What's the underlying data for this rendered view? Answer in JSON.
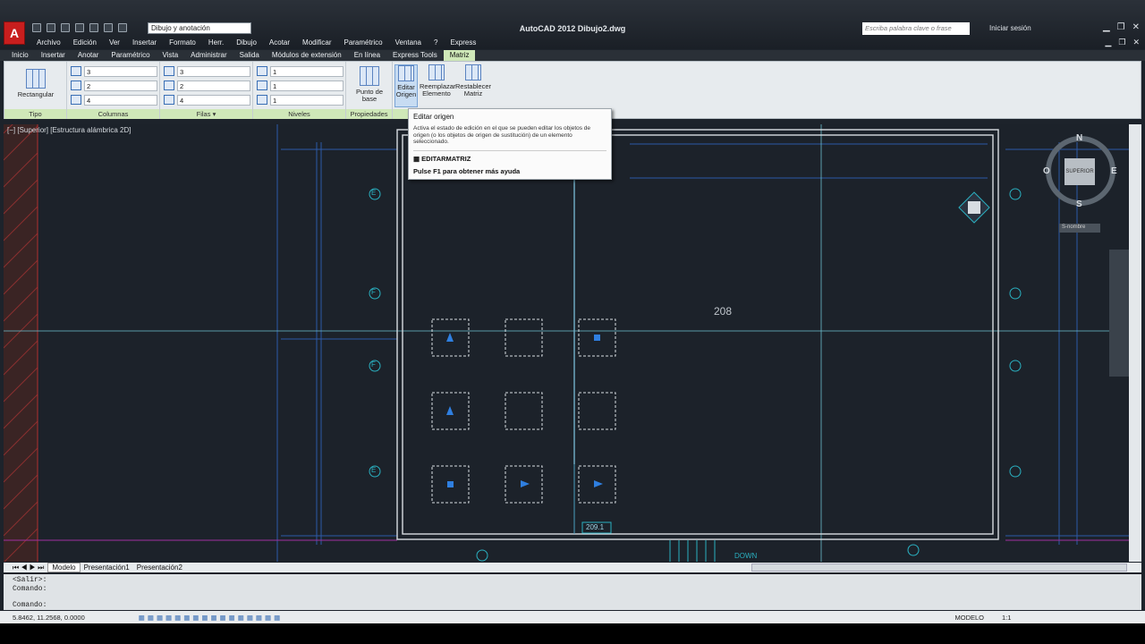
{
  "titlebar": {
    "app_icon": "A",
    "workspace": "Dibujo y anotación",
    "title": "AutoCAD 2012    Dibujo2.dwg",
    "search_placeholder": "Escriba palabra clave o frase",
    "signin": "Iniciar sesión"
  },
  "menu": [
    "Archivo",
    "Edición",
    "Ver",
    "Insertar",
    "Formato",
    "Herr.",
    "Dibujo",
    "Acotar",
    "Modificar",
    "Paramétrico",
    "Ventana",
    "?",
    "Express"
  ],
  "ribbon_tabs": [
    "Inicio",
    "Insertar",
    "Anotar",
    "Paramétrico",
    "Vista",
    "Administrar",
    "Salida",
    "Módulos de extensión",
    "En línea",
    "Express Tools",
    "Matriz"
  ],
  "ribbon": {
    "tipo": {
      "label": "Rectangular",
      "footer": "Tipo"
    },
    "columnas": {
      "footer": "Columnas",
      "values": [
        "3",
        "2",
        "4"
      ]
    },
    "filas": {
      "footer": "Filas",
      "values": [
        "3",
        "2",
        "4"
      ]
    },
    "niveles": {
      "footer": "Niveles",
      "values": [
        "1",
        "1",
        "1"
      ]
    },
    "propiedades": {
      "footer": "Propiedades",
      "punto_base": "Punto de base"
    },
    "opciones": {
      "editar": "Editar Origen",
      "reemplazar": "Reemplazar Elemento",
      "restablecer": "Restablecer Matriz"
    }
  },
  "viewport": {
    "label": "[−] [Superior] [Estructura alámbrica 2D]",
    "room": "208",
    "room2": "209.1",
    "down": "DOWN",
    "grid_letters": [
      "E",
      "F",
      "F",
      "E"
    ],
    "compass": {
      "n": "N",
      "s": "S",
      "e": "E",
      "o": "O",
      "center": "SUPERIOR"
    },
    "wcs": "S-nombre"
  },
  "tooltip": {
    "title": "Editar origen",
    "desc": "Activa el estado de edición en el que se pueden editar los objetos de origen (o los objetos de origen de sustitución) de un elemento seleccionado.",
    "cmd": "EDITARMATRIZ",
    "help": "Pulse F1 para obtener más ayuda"
  },
  "layout_tabs": [
    "Modelo",
    "Presentación1",
    "Presentación2"
  ],
  "command": {
    "lines": [
      "<Salir>:",
      "Comando:"
    ],
    "prompt": "Comando:"
  },
  "status": {
    "coords": "5.8462, 11.2568, 0.0000",
    "model": "MODELO",
    "scale": "1:1"
  }
}
